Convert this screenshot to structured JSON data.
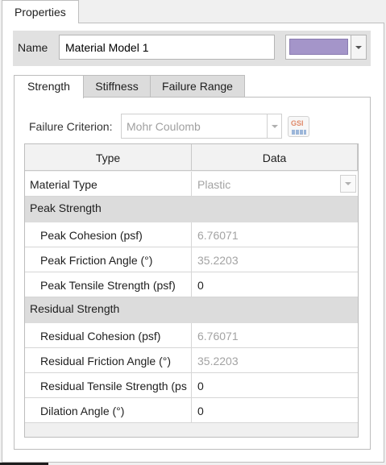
{
  "window": {
    "tab_label": "Properties"
  },
  "name_field": {
    "label": "Name",
    "value": "Material Model 1",
    "color": "#a495c9"
  },
  "tabs": [
    {
      "label": "Strength",
      "active": true
    },
    {
      "label": "Stiffness",
      "active": false
    },
    {
      "label": "Failure Range",
      "active": false
    }
  ],
  "failure_criterion": {
    "label": "Failure Criterion:",
    "value": "Mohr Coulomb",
    "gsi_button": "GSI"
  },
  "grid": {
    "headers": [
      "Type",
      "Data"
    ],
    "material_type": {
      "label": "Material Type",
      "value": "Plastic"
    },
    "peak_section": "Peak Strength",
    "peak_rows": [
      {
        "label": "Peak Cohesion (psf)",
        "value": "6.76071",
        "editable": false
      },
      {
        "label": "Peak Friction Angle (°)",
        "value": "35.2203",
        "editable": false
      },
      {
        "label": "Peak Tensile Strength (psf)",
        "value": "0",
        "editable": true
      }
    ],
    "residual_section": "Residual Strength",
    "residual_rows": [
      {
        "label": "Residual Cohesion (psf)",
        "value": "6.76071",
        "editable": false
      },
      {
        "label": "Residual Friction Angle (°)",
        "value": "35.2203",
        "editable": false
      },
      {
        "label": "Residual Tensile Strength (ps",
        "value": "0",
        "editable": true
      },
      {
        "label": "Dilation Angle (°)",
        "value": "0",
        "editable": true
      }
    ]
  }
}
